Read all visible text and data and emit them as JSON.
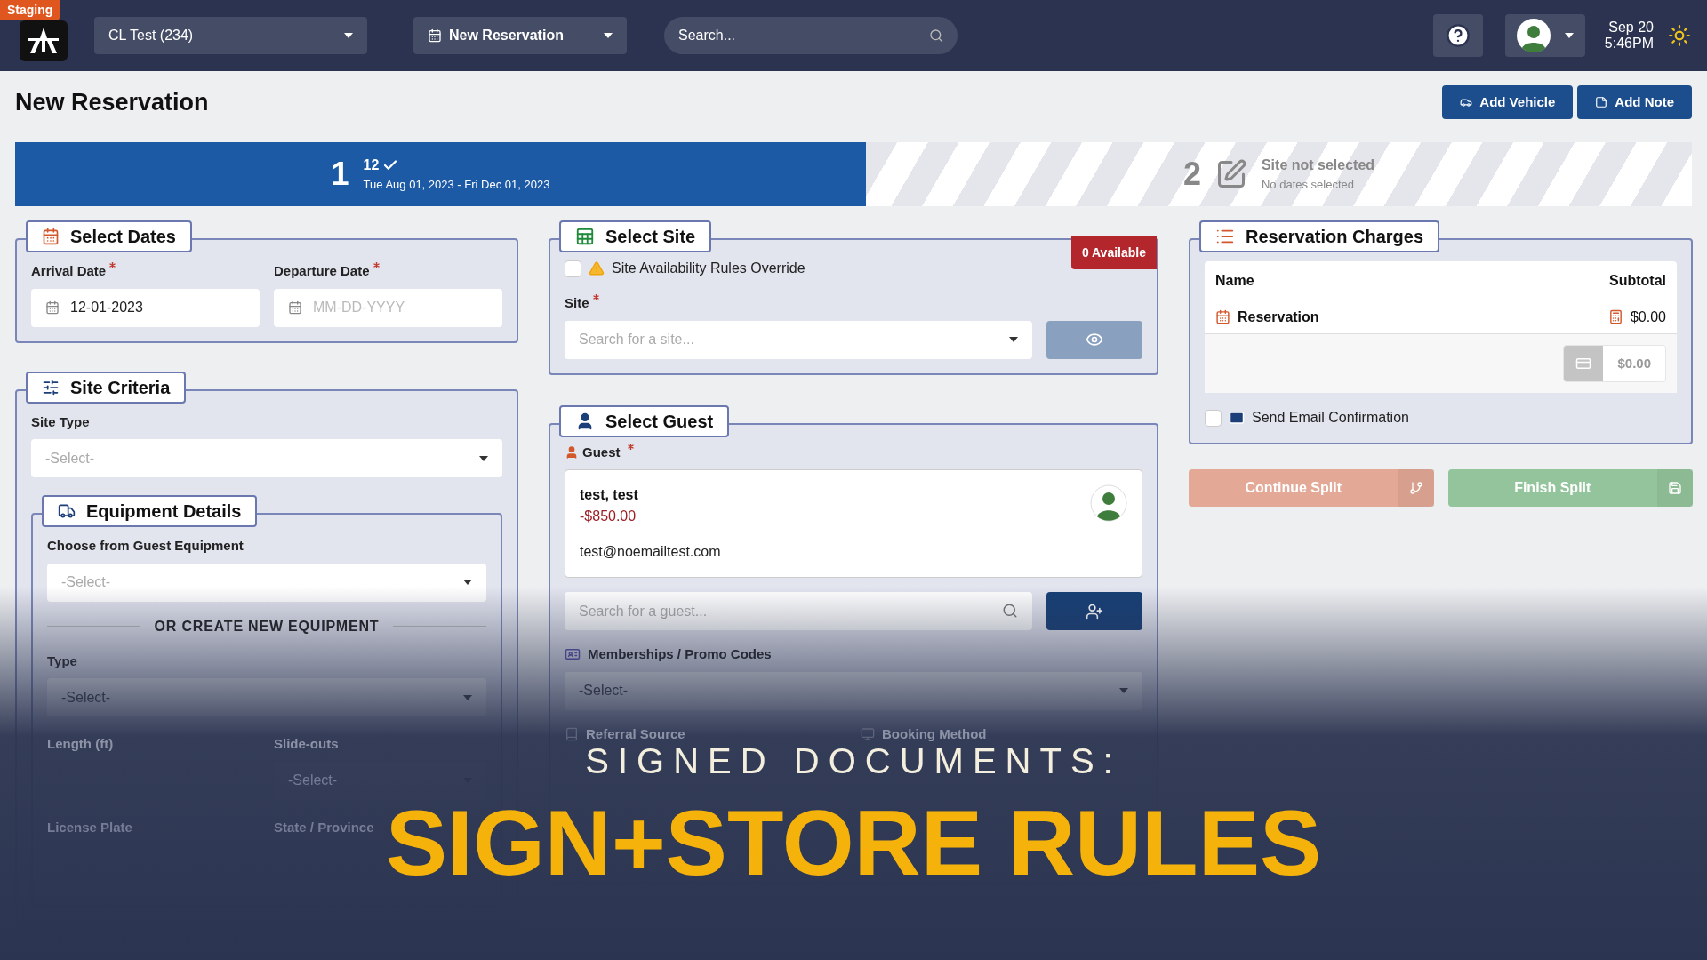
{
  "top_bar": {
    "env_badge": "Staging",
    "park_select": "CL Test (234)",
    "new_button": "New Reservation",
    "search": {
      "placeholder": "Search..."
    },
    "date": "Sep 20",
    "time": "5:46PM"
  },
  "page": {
    "title": "New Reservation",
    "actions": [
      "Add Vehicle",
      "Add Note"
    ]
  },
  "steps": [
    {
      "number": "1",
      "title": "12",
      "done": true,
      "subtitle": "Tue Aug 01, 2023 - Fri Dec 01, 2023",
      "selected": true
    },
    {
      "number": "2",
      "title": "Site not selected",
      "done": false,
      "subtitle": "No dates selected",
      "selected": false
    }
  ],
  "select_dates": {
    "title": "Select Dates",
    "fields": [
      {
        "label": "Arrival Date",
        "required": true,
        "value": "12-01-2023"
      },
      {
        "label": "Departure Date",
        "required": true,
        "placeholder": "MM-DD-YYYY"
      }
    ]
  },
  "site_criteria": {
    "title": "Site Criteria",
    "site_type": {
      "label": "Site Type",
      "placeholder": "-Select-"
    },
    "equipment": {
      "title": "Equipment Details",
      "guest_equipment": {
        "label": "Choose from Guest Equipment",
        "placeholder": "-Select-"
      },
      "divider": "OR CREATE NEW EQUIPMENT",
      "type": {
        "label": "Type",
        "placeholder": "-Select-"
      },
      "length_label": "Length (ft)",
      "slideouts": {
        "label": "Slide-outs",
        "placeholder": "-Select-"
      },
      "license_plate_label": "License Plate",
      "state_label": "State / Province"
    }
  },
  "select_site": {
    "title": "Select Site",
    "availability": "0 Available",
    "override": {
      "label": "Site Availability Rules Override",
      "checked": false
    },
    "site": {
      "label": "Site",
      "required": true,
      "placeholder": "Search for a site..."
    }
  },
  "select_guest": {
    "title": "Select Guest",
    "guest_label": "Guest",
    "required": true,
    "guest": {
      "name": "test, test",
      "balance": "-$850.00",
      "email": "test@noemailtest.com"
    },
    "search": {
      "placeholder": "Search for a guest..."
    },
    "memberships": {
      "label": "Memberships / Promo Codes",
      "placeholder": "-Select-"
    },
    "referral_label": "Referral Source",
    "booking_label": "Booking Method"
  },
  "charges": {
    "title": "Reservation Charges",
    "columns": [
      "Name",
      "Subtotal"
    ],
    "rows": [
      {
        "name": "Reservation",
        "subtotal": "$0.00"
      }
    ],
    "total": "$0.00",
    "send_email": {
      "label": "Send Email Confirmation",
      "checked": false
    }
  },
  "split_buttons": [
    "Continue Split",
    "Finish Split"
  ],
  "overlay": {
    "subtitle": "SIGNED DOCUMENTS:",
    "title": "SIGN+STORE RULES"
  }
}
